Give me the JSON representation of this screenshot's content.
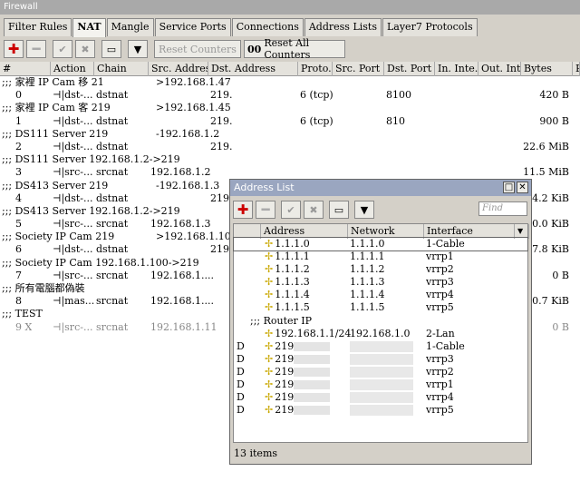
{
  "window_title": "Firewall",
  "tabs": [
    "Filter Rules",
    "NAT",
    "Mangle",
    "Service Ports",
    "Connections",
    "Address Lists",
    "Layer7 Protocols"
  ],
  "toolbar": {
    "reset_counters": "Reset Counters",
    "reset_all_counters": "Reset All Counters",
    "oo": "00"
  },
  "columns": [
    "#",
    "Action",
    "Chain",
    "Src. Address",
    "Dst. Address",
    "Proto...",
    "Src. Port",
    "Dst. Port",
    "In. Inte...",
    "Out. Int...",
    "Bytes",
    "P"
  ],
  "rows": [
    {
      "type": "comment",
      "text": ";;; 家裡 IP Cam 移 21",
      "dst": ">192.168.1.47"
    },
    {
      "type": "rule",
      "num": "0",
      "action": "dst-...",
      "chain": "dstnat",
      "src": "",
      "dst": "219.",
      "proto": "6 (tcp)",
      "dport": "8100",
      "bytes": "420 B"
    },
    {
      "type": "comment",
      "text": ";;; 家裡 IP Cam 客 219",
      "dst": ">192.168.1.45"
    },
    {
      "type": "rule",
      "num": "1",
      "action": "dst-...",
      "chain": "dstnat",
      "src": "",
      "dst": "219.",
      "proto": "6 (tcp)",
      "dport": "810",
      "bytes": "900 B"
    },
    {
      "type": "comment",
      "text": ";;; DS111 Server 219",
      "dst": "-192.168.1.2"
    },
    {
      "type": "rule",
      "num": "2",
      "action": "dst-...",
      "chain": "dstnat",
      "src": "",
      "dst": "219.",
      "proto": "",
      "dport": "",
      "bytes": "22.6 MiB"
    },
    {
      "type": "comment",
      "text": ";;; DS111 Server 192.168.1.2->219",
      "dst": ""
    },
    {
      "type": "rule",
      "num": "3",
      "action": "src-...",
      "chain": "srcnat",
      "src": "192.168.1.2",
      "dst": "",
      "proto": "",
      "dport": "",
      "bytes": "11.5 MiB"
    },
    {
      "type": "comment",
      "text": ";;; DS413 Server 219",
      "dst": "-192.168.1.3"
    },
    {
      "type": "rule",
      "num": "4",
      "action": "dst-...",
      "chain": "dstnat",
      "src": "",
      "dst": "219.",
      "proto": "",
      "dport": "",
      "bytes": "34.2 KiB"
    },
    {
      "type": "comment",
      "text": ";;; DS413 Server  192.168.1.2->219",
      "dst": ""
    },
    {
      "type": "rule",
      "num": "5",
      "action": "src-...",
      "chain": "srcnat",
      "src": "192.168.1.3",
      "dst": "",
      "proto": "",
      "dport": "",
      "bytes": "10.0 KiB"
    },
    {
      "type": "comment",
      "text": ";;; Society IP Cam 219",
      "dst": ">192.168.1.100"
    },
    {
      "type": "rule",
      "num": "6",
      "action": "dst-...",
      "chain": "dstnat",
      "src": "",
      "dst": "219.",
      "proto": "",
      "dport": "",
      "bytes": "67.8 KiB"
    },
    {
      "type": "comment",
      "text": ";;; Society IP Cam 192.168.1.100->219",
      "dst": ""
    },
    {
      "type": "rule",
      "num": "7",
      "action": "src-...",
      "chain": "srcnat",
      "src": "192.168.1....",
      "dst": "",
      "proto": "",
      "dport": "",
      "bytes": "0 B"
    },
    {
      "type": "comment",
      "text": ";;; 所有電腦都偽裝",
      "dst": ""
    },
    {
      "type": "rule",
      "num": "8",
      "action": "mas...",
      "chain": "srcnat",
      "src": "192.168.1....",
      "dst": "",
      "proto": "",
      "dport": "",
      "bytes": "40.7 KiB"
    },
    {
      "type": "comment",
      "text": ";;; TEST",
      "dst": ""
    },
    {
      "type": "rule",
      "num": "9 X",
      "action": "src-...",
      "chain": "srcnat",
      "src": "192.168.1.11",
      "dst": "",
      "proto": "",
      "dport": "",
      "bytes": "0 B",
      "disabled": true
    }
  ],
  "address_list": {
    "title": "Address List",
    "find_placeholder": "Find",
    "columns": [
      "Address",
      "Network",
      "Interface"
    ],
    "rows": [
      {
        "flag": "",
        "address": "1.1.1.0",
        "network": "1.1.1.0",
        "interface": "1-Cable"
      },
      {
        "flag": "",
        "address": "1.1.1.1",
        "network": "1.1.1.1",
        "interface": "vrrp1"
      },
      {
        "flag": "",
        "address": "1.1.1.2",
        "network": "1.1.1.2",
        "interface": "vrrp2"
      },
      {
        "flag": "",
        "address": "1.1.1.3",
        "network": "1.1.1.3",
        "interface": "vrrp3"
      },
      {
        "flag": "",
        "address": "1.1.1.4",
        "network": "1.1.1.4",
        "interface": "vrrp4"
      },
      {
        "flag": "",
        "address": "1.1.1.5",
        "network": "1.1.1.5",
        "interface": "vrrp5"
      },
      {
        "flag": "comment",
        "address": ";;; Router IP",
        "network": "",
        "interface": ""
      },
      {
        "flag": "",
        "address": "192.168.1.1/24",
        "network": "192.168.1.0",
        "interface": "2-Lan"
      },
      {
        "flag": "D",
        "address": "219",
        "network": "",
        "interface": "1-Cable"
      },
      {
        "flag": "D",
        "address": "219",
        "network": "",
        "interface": "vrrp3"
      },
      {
        "flag": "D",
        "address": "219",
        "network": "",
        "interface": "vrrp2"
      },
      {
        "flag": "D",
        "address": "219",
        "network": "",
        "interface": "vrrp1"
      },
      {
        "flag": "D",
        "address": "219",
        "network": "",
        "interface": "vrrp4"
      },
      {
        "flag": "D",
        "address": "219",
        "network": "",
        "interface": "vrrp5"
      }
    ],
    "status": "13 items"
  }
}
